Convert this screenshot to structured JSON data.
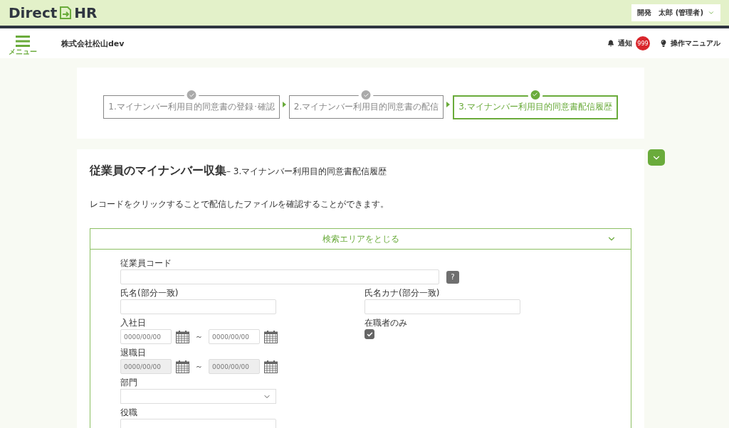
{
  "header": {
    "logo": {
      "left": "Direct",
      "right": "HR"
    },
    "user_menu": "開発　太郎 (管理者)"
  },
  "nav": {
    "menu_label": "メニュー",
    "company": "株式会社松山dev",
    "notification": {
      "label": "通知",
      "count": "999"
    },
    "manual": "操作マニュアル"
  },
  "steps": [
    {
      "label": "1.マイナンバー利用目的同意書の登録･確認",
      "selected": false
    },
    {
      "label": "2.マイナンバー利用目的同意書の配信",
      "selected": false
    },
    {
      "label": "3.マイナンバー利用目的同意書配信履歴",
      "selected": true
    }
  ],
  "page": {
    "title": "従業員のマイナンバー収集",
    "subtitle": "– 3.マイナンバー利用目的同意書配信履歴",
    "description": "レコードをクリックすることで配信したファイルを確認することができます。"
  },
  "search": {
    "toggle_label": "検索エリアをとじる",
    "expanded": true,
    "rows": [
      [
        {
          "kind": "text",
          "label": "従業員コード",
          "wide": true,
          "help": "?"
        }
      ],
      [
        {
          "kind": "text",
          "label": "氏名(部分一致)"
        },
        {
          "kind": "text",
          "label": "氏名カナ(部分一致)"
        }
      ],
      [
        {
          "kind": "date_range",
          "label": "入社日",
          "separator": "～",
          "from": {
            "placeholder": "0000/00/00",
            "disabled": false
          },
          "to": {
            "placeholder": "0000/00/00",
            "disabled": false
          }
        },
        {
          "kind": "checkbox",
          "label": "在職者のみ",
          "checked": true
        }
      ],
      [
        {
          "kind": "date_range",
          "label": "退職日",
          "separator": "～",
          "from": {
            "placeholder": "0000/00/00",
            "disabled": true
          },
          "to": {
            "placeholder": "0000/00/00",
            "disabled": true
          }
        }
      ],
      [
        {
          "kind": "select",
          "label": "部門"
        }
      ],
      [
        {
          "kind": "text",
          "label": "役職"
        }
      ]
    ]
  }
}
